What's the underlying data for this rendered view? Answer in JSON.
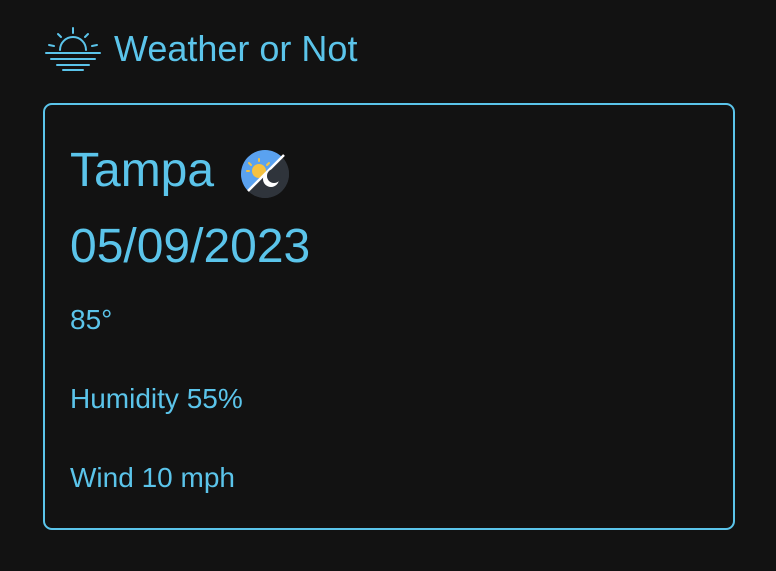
{
  "app": {
    "title": "Weather or Not",
    "logo_icon": "sunset-icon"
  },
  "weather": {
    "city": "Tampa",
    "condition_icon": "partly-cloudy-night-icon",
    "date": "05/09/2023",
    "temperature": "85°",
    "humidity": "Humidity 55%",
    "wind": "Wind 10 mph"
  },
  "colors": {
    "background": "#121212",
    "accent": "#5bc4ea",
    "icon_bg": "#2f343b",
    "icon_sky": "#5aa2f0",
    "icon_sun": "#f5c242",
    "icon_moon": "#ffffff"
  }
}
